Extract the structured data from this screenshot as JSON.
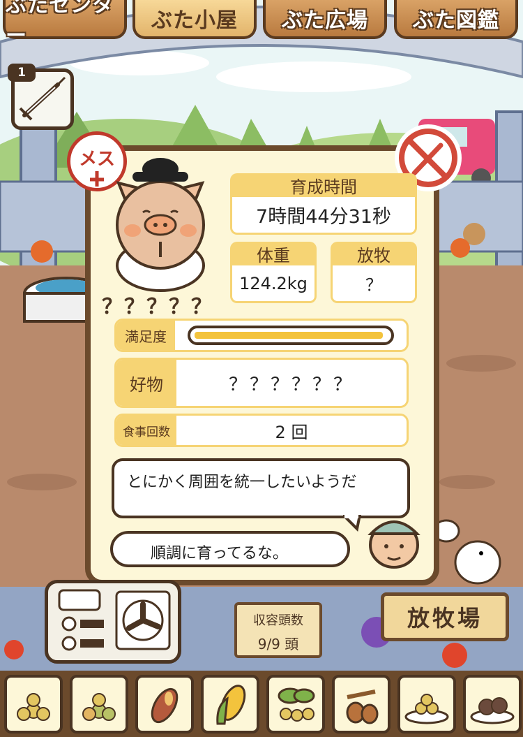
{
  "tabs": [
    {
      "label": "ぶたセンター"
    },
    {
      "label": "ぶた小屋"
    },
    {
      "label": "ぶた広場"
    },
    {
      "label": "ぶた図鑑"
    }
  ],
  "item_slot": {
    "count": "1"
  },
  "pig": {
    "gender": "メス",
    "name": "？？？？？",
    "growth_time_label": "育成時間",
    "growth_time_value": "7時間44分31秒",
    "weight_label": "体重",
    "weight_value": "124.2kg",
    "grazing_label": "放牧",
    "grazing_value": "？",
    "satisfaction_label": "満足度",
    "satisfaction_level": 0.98,
    "favorite_label": "好物",
    "favorite_value": "？？？？？？",
    "meals_label": "食事回数",
    "meals_value": "2 回"
  },
  "pig_message": "とにかく周囲を統一したいようだ",
  "farmer_message": "順調に育ってるな。",
  "capacity": {
    "label": "収容頭数",
    "value": "9/9 頭"
  },
  "grazing_sign": "放牧場",
  "food_items": [
    "grain-pile-icon",
    "mixed-grain-icon",
    "sweet-potato-icon",
    "corn-icon",
    "beans-leaf-icon",
    "acorn-icon",
    "grain-plate-icon",
    "meatball-plate-icon"
  ]
}
